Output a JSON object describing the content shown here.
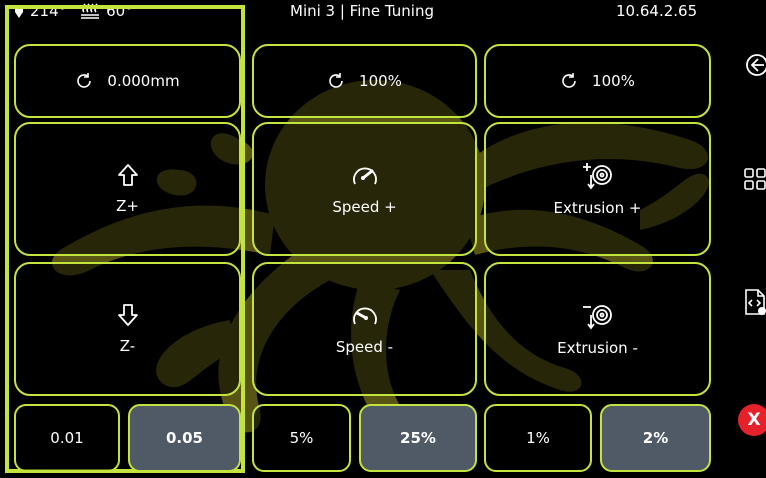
{
  "status": {
    "nozzle_temp": "214°",
    "bed_temp": "60°",
    "title": "Mini 3 | Fine Tuning",
    "ip": "10.64.2.65"
  },
  "z_offset": {
    "value": "0.000mm",
    "up_label": "Z+",
    "down_label": "Z-",
    "steps": [
      "0.01",
      "0.05"
    ],
    "active_step": "0.05"
  },
  "speed": {
    "value": "100%",
    "up_label": "Speed +",
    "down_label": "Speed -",
    "steps": [
      "5%",
      "25%"
    ],
    "active_step": "25%"
  },
  "extrusion": {
    "value": "100%",
    "up_label": "Extrusion +",
    "down_label": "Extrusion -",
    "steps": [
      "1%",
      "2%"
    ],
    "active_step": "2%"
  },
  "sidebar": {
    "icons": [
      "back-icon",
      "grid-menu-icon",
      "macro-icon",
      "emergency-stop-icon"
    ],
    "emergency_label": "X"
  },
  "colors": {
    "accent": "#c3e33f",
    "active_bg": "#4f5a66",
    "stop": "#e5222b",
    "logo": "#5d5a16"
  }
}
